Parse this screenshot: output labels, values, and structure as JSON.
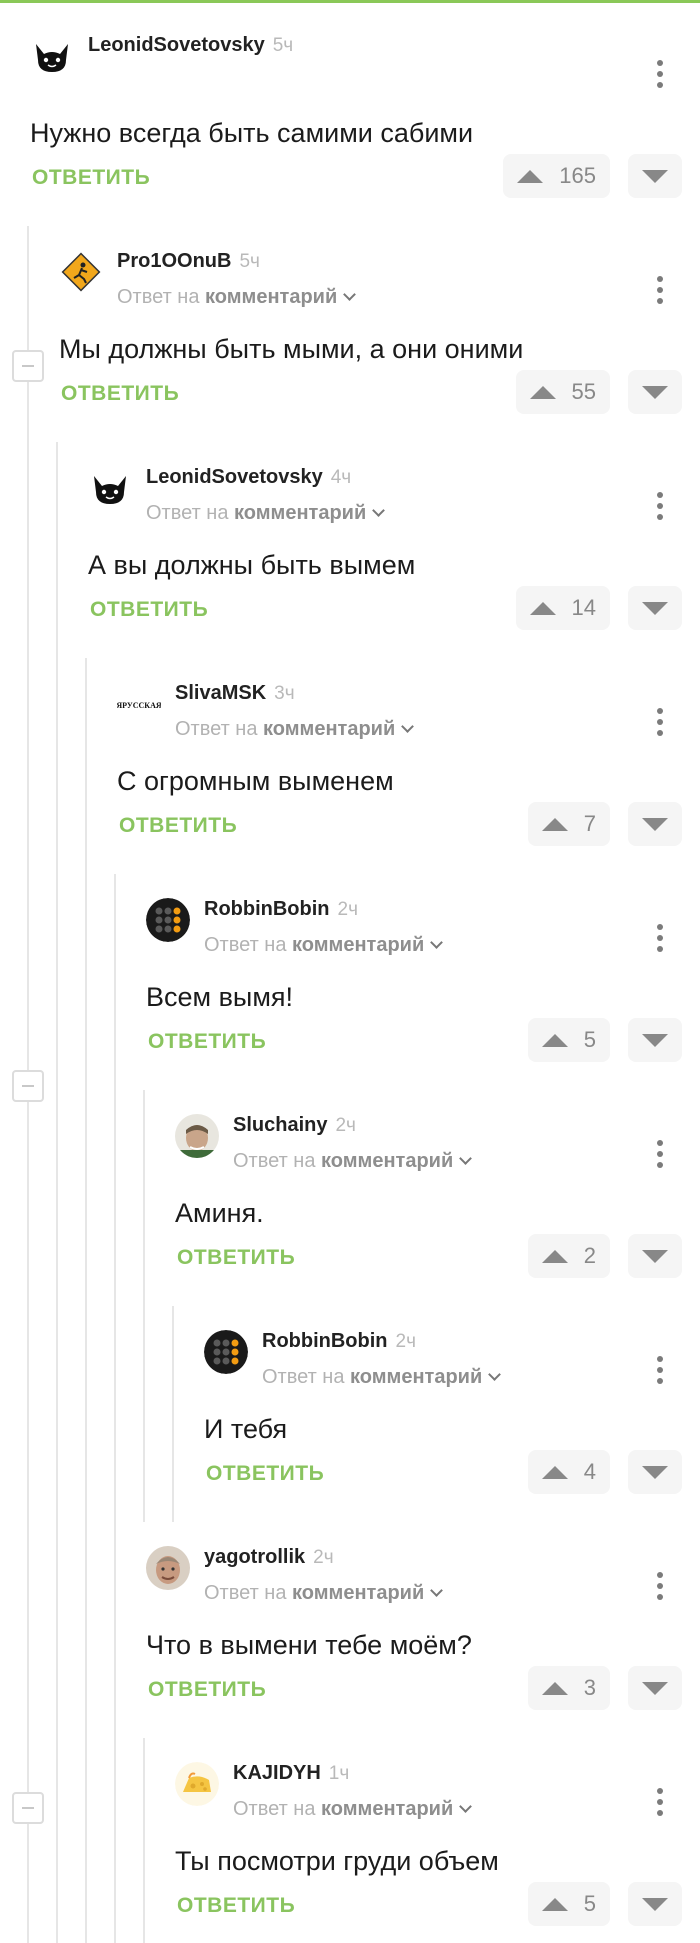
{
  "comments": [
    {
      "username": "LeonidSovetovsky",
      "time": "5ч",
      "text": "Нужно всегда быть самими сабими",
      "reply_label": "ОТВЕТИТЬ",
      "score": "165",
      "avatar": "cat-avatar"
    },
    {
      "username": "Pro1OOnuB",
      "time": "5ч",
      "reply_prefix": "Ответ на",
      "reply_target": "комментарий",
      "text": "Мы должны быть мыми, а они оними",
      "reply_label": "ОТВЕТИТЬ",
      "score": "55",
      "avatar": "warning-sign-avatar"
    },
    {
      "username": "LeonidSovetovsky",
      "time": "4ч",
      "reply_prefix": "Ответ на",
      "reply_target": "комментарий",
      "text": "А вы должны быть вымем",
      "reply_label": "ОТВЕТИТЬ",
      "score": "14",
      "avatar": "cat-avatar"
    },
    {
      "username": "SlivaMSK",
      "time": "3ч",
      "reply_prefix": "Ответ на",
      "reply_target": "комментарий",
      "text": "С огромным выменем",
      "reply_label": "ОТВЕТИТЬ",
      "score": "7",
      "avatar": "text-logo-avatar",
      "avatar_text": "ЯРУССКАЯ"
    },
    {
      "username": "RobbinBobin",
      "time": "2ч",
      "reply_prefix": "Ответ на",
      "reply_target": "комментарий",
      "text": "Всем вымя!",
      "reply_label": "ОТВЕТИТЬ",
      "score": "5",
      "avatar": "keypad-avatar"
    },
    {
      "username": "Sluchainy",
      "time": "2ч",
      "reply_prefix": "Ответ на",
      "reply_target": "комментарий",
      "text": "Аминя.",
      "reply_label": "ОТВЕТИТЬ",
      "score": "2",
      "avatar": "photo-avatar"
    },
    {
      "username": "RobbinBobin",
      "time": "2ч",
      "reply_prefix": "Ответ на",
      "reply_target": "комментарий",
      "text": "И тебя",
      "reply_label": "ОТВЕТИТЬ",
      "score": "4",
      "avatar": "keypad-avatar"
    },
    {
      "username": "yagotrollik",
      "time": "2ч",
      "reply_prefix": "Ответ на",
      "reply_target": "комментарий",
      "text": "Что в вымени тебе моём?",
      "reply_label": "ОТВЕТИТЬ",
      "score": "3",
      "avatar": "photo-avatar"
    },
    {
      "username": "KAJIDYH",
      "time": "1ч",
      "reply_prefix": "Ответ на",
      "reply_target": "комментарий",
      "text": "Ты посмотри груди объем",
      "reply_label": "ОТВЕТИТЬ",
      "score": "5",
      "avatar": "cheese-avatar"
    }
  ],
  "colors": {
    "accent": "#8ac45f",
    "top_bar": "#8ac858",
    "muted": "#b2b2b2",
    "vote_bg": "#f5f5f5"
  }
}
